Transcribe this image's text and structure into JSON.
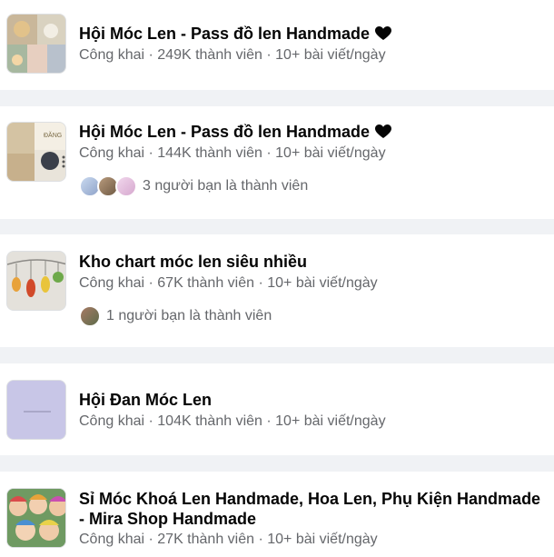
{
  "groups": [
    {
      "title": "Hội Móc Len - Pass đồ len Handmade",
      "suffix_icon": "black-heart-icon",
      "privacy": "Công khai",
      "members": "249K thành viên",
      "posts": "10+ bài viết/ngày",
      "friends_text": ""
    },
    {
      "title": "Hội Móc Len - Pass đồ len Handmade",
      "suffix_icon": "black-heart-icon",
      "privacy": "Công khai",
      "members": "144K thành viên",
      "posts": "10+ bài viết/ngày",
      "friends_text": "3 người bạn là thành viên"
    },
    {
      "title": "Kho chart móc len siêu nhiều",
      "privacy": "Công khai",
      "members": "67K thành viên",
      "posts": "10+ bài viết/ngày",
      "friends_text": "1 người bạn là thành viên"
    },
    {
      "title": "Hội Đan Móc Len",
      "privacy": "Công khai",
      "members": "104K thành viên",
      "posts": "10+ bài viết/ngày",
      "friends_text": ""
    },
    {
      "title": "Sỉ Móc Khoá Len Handmade, Hoa Len, Phụ Kiện Handmade - Mira Shop Handmade",
      "privacy": "Công khai",
      "members": "27K thành viên",
      "posts": "10+ bài viết/ngày",
      "friends_text": ""
    }
  ],
  "separator": " · ",
  "colors": {
    "background": "#f0f2f5",
    "card": "#ffffff",
    "secondary_text": "#65676b"
  }
}
